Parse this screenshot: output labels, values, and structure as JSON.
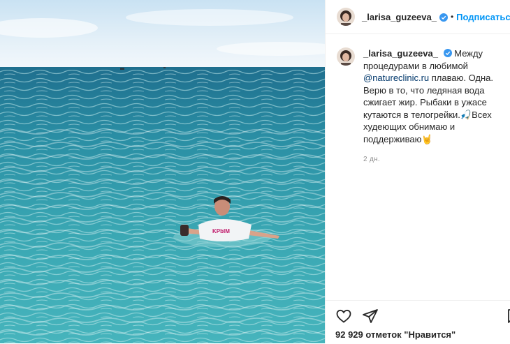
{
  "post": {
    "username": "_larisa_guzeeva_",
    "follow_label": "Подписаться",
    "separator": "•",
    "caption_before": "Между процедурами в любимой",
    "mention": "@natureclinic.ru",
    "caption_after": "плаваю. Одна. Верю в то, что ледяная вода сжигает жир. Рыбаки в ужасе кутаются в телогрейки.",
    "emoji_fish": "🎣",
    "caption_end": "Всех худеющих обнимаю и поддерживаю",
    "emoji_hand": "🤘",
    "time": "2 дн.",
    "likes": "92 929 отметок \"Нравится\""
  },
  "photo": {
    "shirt_text": "KPbIM",
    "sky_color": "#d6e9f6",
    "sea_color": "#3fa6b3"
  },
  "icons": [
    "heart-icon",
    "share-icon",
    "bookmark-icon",
    "verified-icon"
  ],
  "colors": {
    "accent": "#0095f6",
    "verified": "#3897f0",
    "mention": "#00376b"
  }
}
